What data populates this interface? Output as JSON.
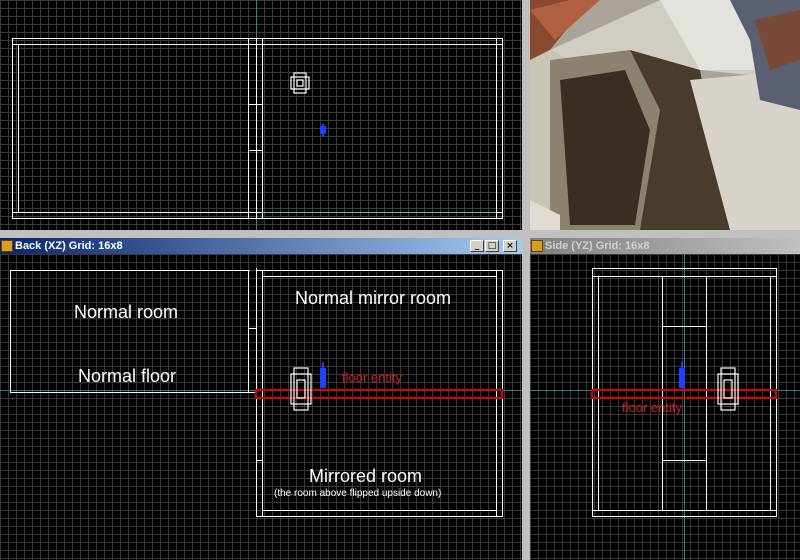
{
  "top_view": {},
  "back_view": {
    "title": "Back (XZ) Grid: 16x8",
    "buttons": {
      "minimize": "_",
      "maximize": "□",
      "close": "×"
    },
    "labels": {
      "normal_room": "Normal room",
      "normal_floor": "Normal floor",
      "normal_mirror_room": "Normal mirror room",
      "floor_entity": "floor entity",
      "mirrored_room": "Mirrored room",
      "mirrored_note": "(the room above flipped upside down)"
    }
  },
  "side_view": {
    "title": "Side (YZ) Grid: 16x8",
    "labels": {
      "floor_entity": "floor entity"
    }
  },
  "colors": {
    "accent_red": "#e00000",
    "entity_blue": "#2040ff",
    "title_active": "#0a246a"
  }
}
